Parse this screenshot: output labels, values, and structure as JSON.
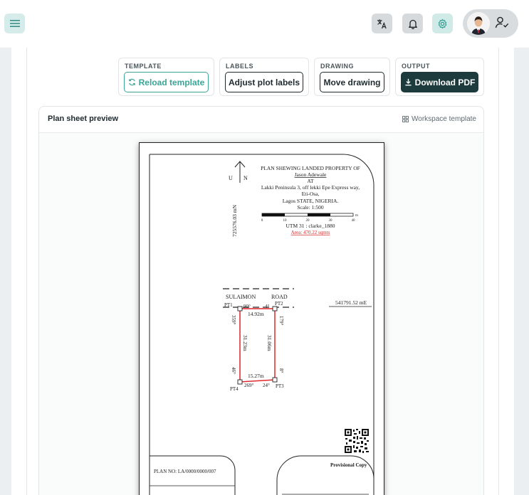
{
  "header": {
    "menu_icon": "hamburger-icon",
    "translate_icon": "translate-icon",
    "bell_icon": "bell-icon",
    "settings_icon": "gear-icon",
    "user_icon": "user-check-icon"
  },
  "toolbar": {
    "template": {
      "label": "TEMPLATE",
      "button": "Reload template",
      "icon": "refresh-icon"
    },
    "labels": {
      "label": "LABELS",
      "button": "Adjust plot labels"
    },
    "drawing": {
      "label": "DRAWING",
      "button": "Move drawing"
    },
    "output": {
      "label": "OUTPUT",
      "button": "Download PDF",
      "icon": "download-icon"
    }
  },
  "preview": {
    "title": "Plan sheet preview",
    "template_label": "Workspace template"
  },
  "sheet": {
    "north_u": "U",
    "north_n": "N",
    "title_lines": [
      "PLAN SHEWING LANDED PROPERTY OF",
      "Jason Adewale",
      "AT",
      "Lakki Peninsula 3, off lekki Epe Express way,",
      "Eti-Osa,",
      "Lagos STATE, NIGERIA.",
      "Scale: 1:500"
    ],
    "scale_ticks": [
      "0",
      "10",
      "20",
      "30",
      "40"
    ],
    "scale_unit": "m",
    "utm": "UTM 31 : clarke_1880",
    "area": "Area: 470.22 sqmts",
    "northing": "725576.03 mN",
    "easting": "541791.52 mE",
    "road_name_1": "SULAIMON",
    "road_name_2": "ROAD",
    "points": {
      "pt1": "PT1",
      "pt2": "PT2",
      "pt3": "PT3",
      "pt4": "PT4"
    },
    "angles": {
      "a1": "90°",
      "a2": "4°",
      "a3": "179°",
      "a4": "359°",
      "a5": "46°",
      "a6": "269°",
      "a7": "24°",
      "a8": "8°"
    },
    "distances": {
      "top": "14.92m",
      "bottom": "15.27m",
      "left": "31.23m",
      "right": "31.06m"
    },
    "plan_no": "PLAN NO: LA/0000/0000/007",
    "provisional": "Provisional Copy"
  },
  "colors": {
    "accent": "#3aa597",
    "dark_button": "#1d3b3c",
    "plot_line": "#e0262b",
    "area_text": "#d62a2a"
  }
}
